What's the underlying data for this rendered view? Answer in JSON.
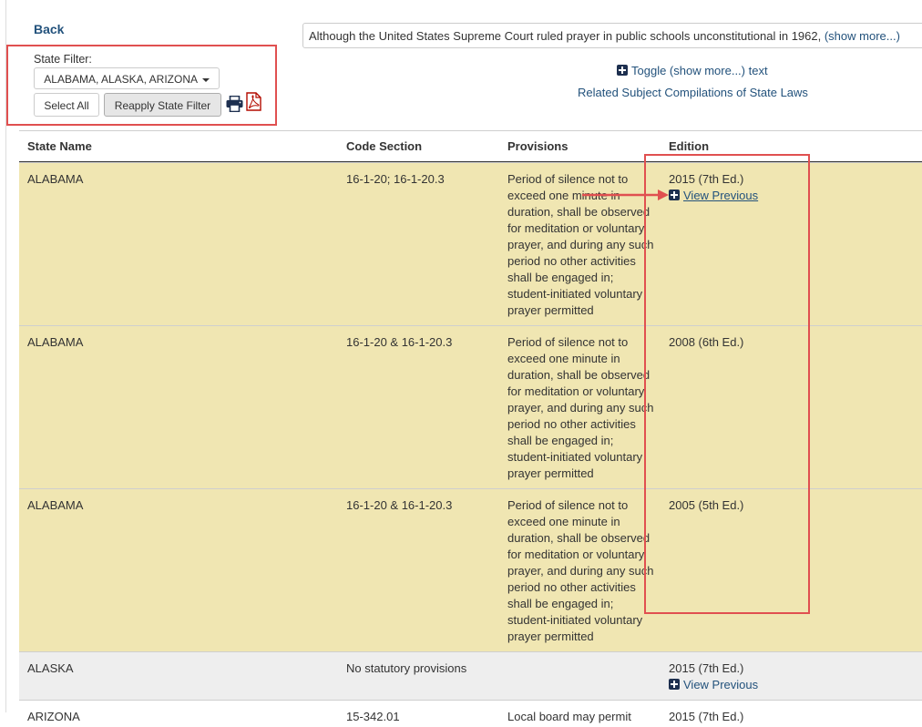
{
  "nav": {
    "back_label": "Back"
  },
  "filter": {
    "label": "State Filter:",
    "selected_states": "ALABAMA, ALASKA, ARIZONA",
    "select_all_label": "Select All",
    "reapply_label": "Reapply State Filter"
  },
  "intro": {
    "text": "Although the United States Supreme Court ruled prayer in public schools unconstitutional in 1962, ",
    "show_more": "(show more...)"
  },
  "toggle": {
    "label": "Toggle (show more...) text"
  },
  "related_link": "Related Subject Compilations of State Laws",
  "table": {
    "headers": {
      "state": "State Name",
      "code": "Code Section",
      "provisions": "Provisions",
      "edition": "Edition"
    },
    "rows": [
      {
        "state": "ALABAMA",
        "code": "16-1-20; 16-1-20.3",
        "provisions": "Period of silence not to exceed one minute in duration, shall be observed for meditation or voluntary prayer, and during any such period no other activities shall be engaged in; student-initiated voluntary prayer permitted",
        "edition": "2015 (7th Ed.)",
        "view_previous": "View Previous"
      },
      {
        "state": "ALABAMA",
        "code": "16-1-20 & 16-1-20.3",
        "provisions": "Period of silence not to exceed one minute in duration, shall be observed for meditation or voluntary prayer, and during any such period no other activities shall be engaged in; student-initiated voluntary prayer permitted",
        "edition": "2008 (6th Ed.)"
      },
      {
        "state": "ALABAMA",
        "code": "16-1-20 & 16-1-20.3",
        "provisions": "Period of silence not to exceed one minute in duration, shall be observed for meditation or voluntary prayer, and during any such period no other activities shall be engaged in; student-initiated voluntary prayer permitted",
        "edition": "2005 (5th Ed.)"
      },
      {
        "state": "ALASKA",
        "code": "No statutory provisions",
        "provisions": "",
        "edition": "2015 (7th Ed.)",
        "view_previous": "View Previous"
      },
      {
        "state": "ARIZONA",
        "code": "15-342.01",
        "provisions": "Local board may permit",
        "edition": "2015 (7th Ed.)"
      }
    ]
  },
  "colors": {
    "link": "#23527c",
    "highlight_row": "#f0e6b2",
    "gray_row": "#eeeeee",
    "annotation_red": "#e05050",
    "pdf_icon": "#b30b00",
    "print_icon": "#1d2f4f"
  },
  "icons": {
    "print": "print-icon",
    "pdf": "pdf-icon",
    "expand": "plus-square-icon",
    "dropdown": "caret-down-icon"
  }
}
